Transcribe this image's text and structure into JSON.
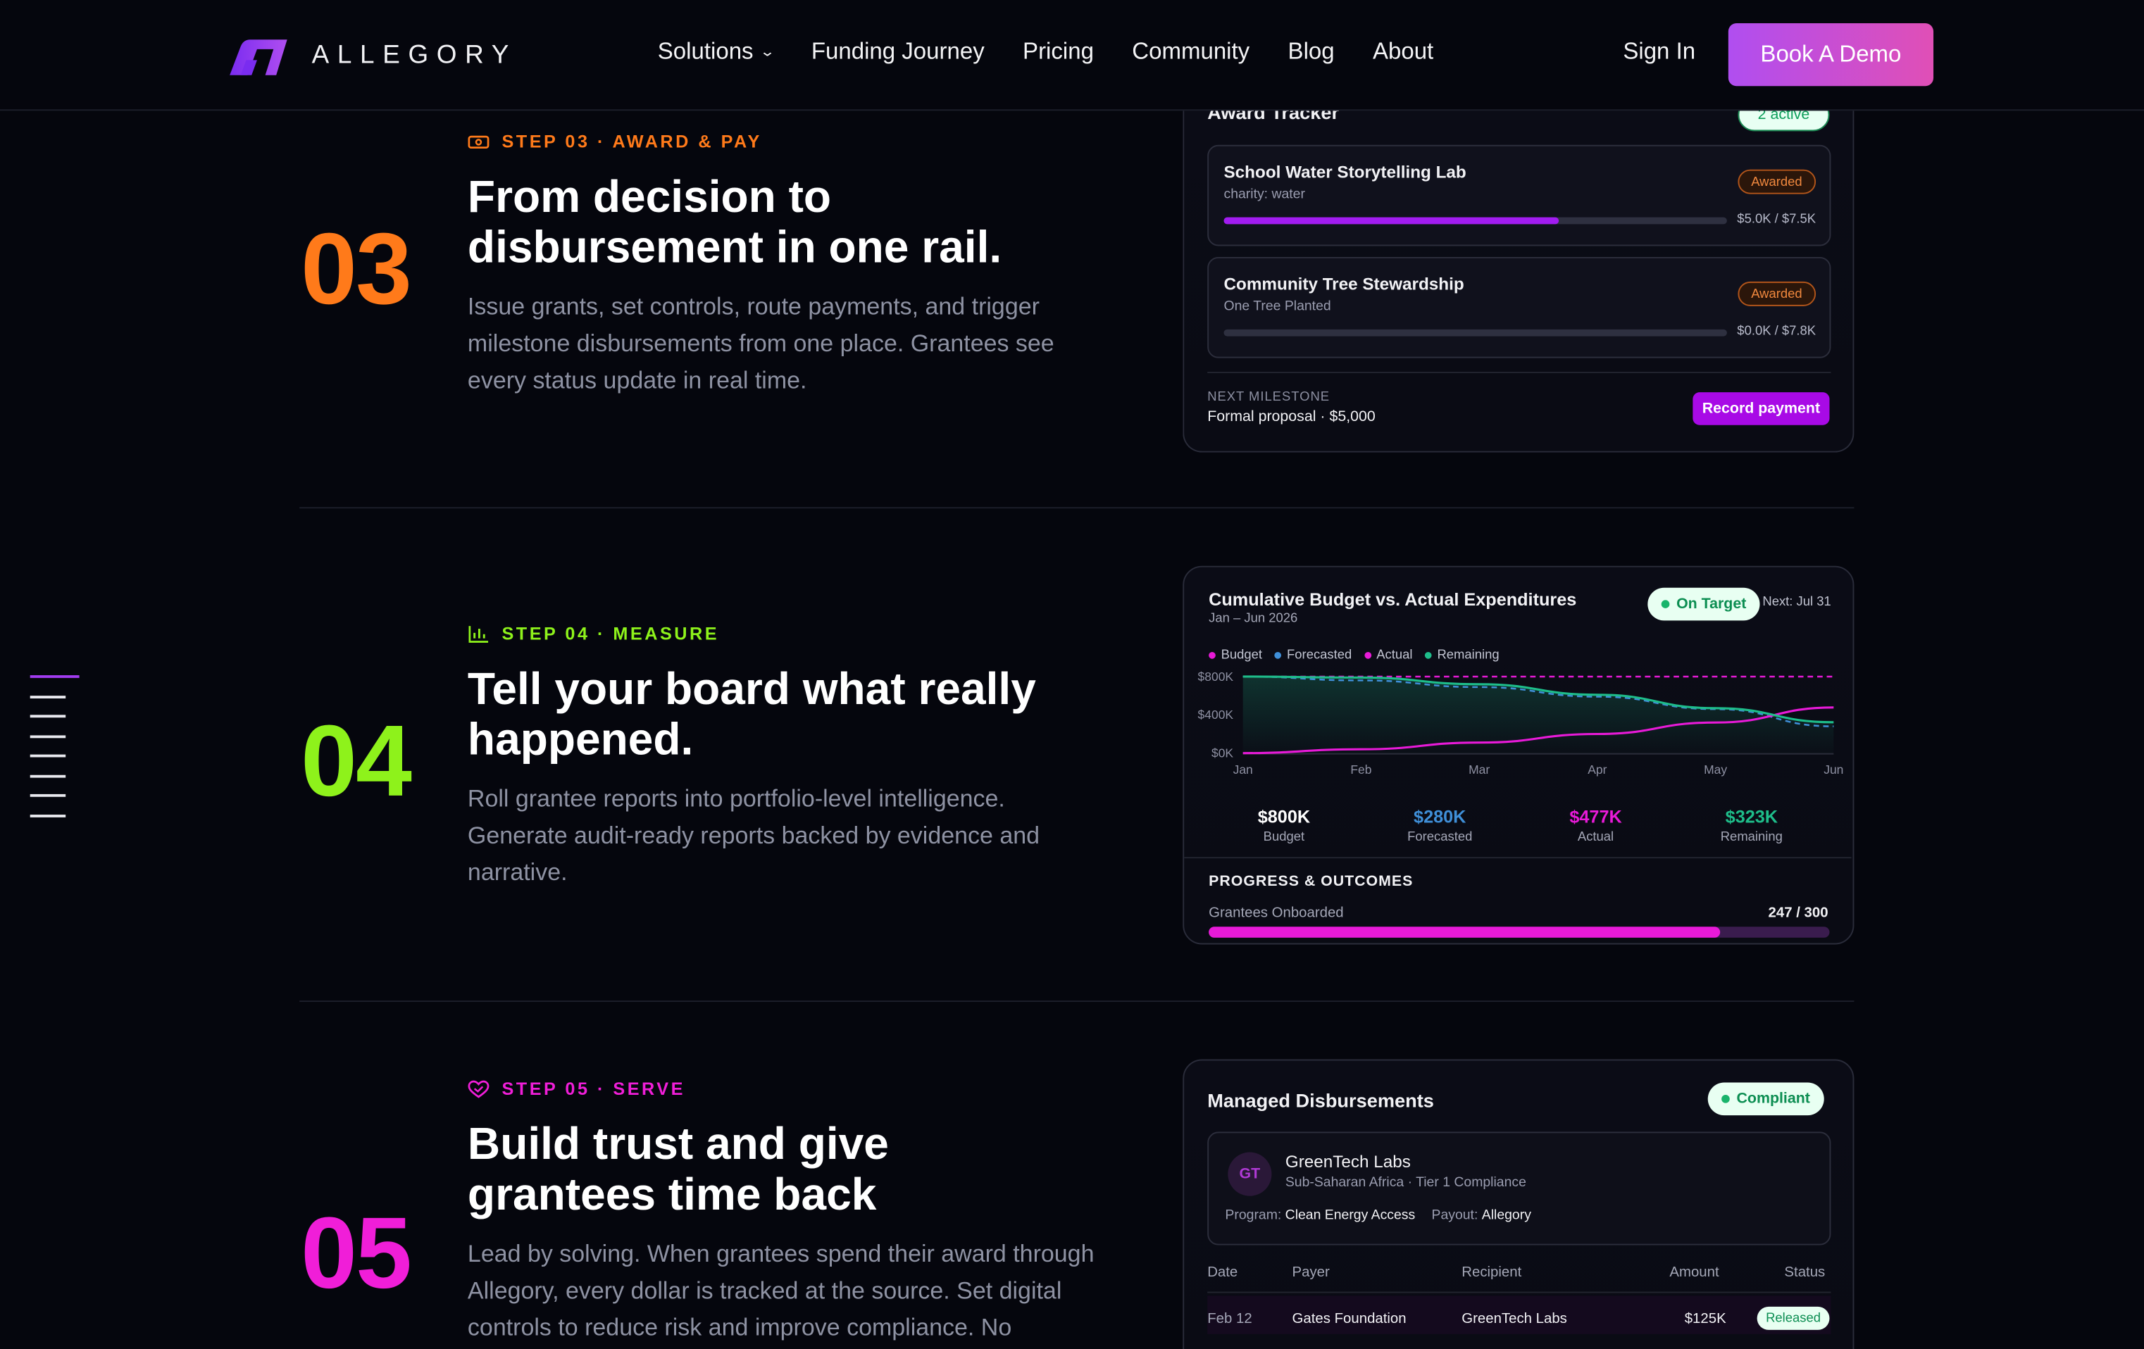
{
  "header": {
    "brand": "ALLEGORY",
    "nav": [
      "Solutions",
      "Funding Journey",
      "Pricing",
      "Community",
      "Blog",
      "About"
    ],
    "sign_in": "Sign In",
    "cta": "Book A Demo"
  },
  "rail": {
    "count": 8,
    "active_index": 0
  },
  "steps": [
    {
      "number": "03",
      "color": "#ff7a1a",
      "eyebrow": "STEP 03 · AWARD & PAY",
      "icon": "banknote-icon",
      "headline": "From decision to disbursement in one rail.",
      "body": "Issue grants, set controls, route payments, and trigger milestone disbursements from one place. Grantees see every status update in real time."
    },
    {
      "number": "04",
      "color": "#8ef21b",
      "eyebrow": "STEP 04 · MEASURE",
      "icon": "bar-chart-icon",
      "headline": "Tell your board what really happened.",
      "body": "Roll grantee reports into portfolio-level intelligence. Generate audit-ready reports backed by evidence and narrative."
    },
    {
      "number": "05",
      "color": "#f01ed8",
      "eyebrow": "STEP 05 · SERVE",
      "icon": "heart-hand-icon",
      "headline": "Build trust and give grantees time back",
      "body": "Lead by solving. When grantees spend their award through Allegory, every dollar is tracked at the source. Set digital controls to reduce risk and improve compliance. No"
    }
  ],
  "award_tracker": {
    "title": "Award Tracker",
    "badge": "2 active",
    "items": [
      {
        "title": "School Water Storytelling Lab",
        "org": "charity: water",
        "status": "Awarded",
        "amount": "$5.0K / $7.5K",
        "progress": 0.667
      },
      {
        "title": "Community Tree Stewardship",
        "org": "One Tree Planted",
        "status": "Awarded",
        "amount": "$0.0K / $7.8K",
        "progress": 0.0
      }
    ],
    "next_milestone_label": "NEXT MILESTONE",
    "next_milestone_value": "Formal proposal · $5,000",
    "action": "Record payment"
  },
  "budget_card": {
    "title": "Cumulative Budget vs. Actual Expenditures",
    "subtitle": "Jan – Jun 2026",
    "status": "On Target",
    "next": "Next: Jul 31",
    "kpis": [
      {
        "value": "$800K",
        "label": "Budget",
        "color": "#ffffff"
      },
      {
        "value": "$280K",
        "label": "Forecasted",
        "color": "#3f8fd8"
      },
      {
        "value": "$477K",
        "label": "Actual",
        "color": "#e81ad8"
      },
      {
        "value": "$323K",
        "label": "Remaining",
        "color": "#1ebd8a"
      }
    ],
    "progress_title": "PROGRESS & OUTCOMES",
    "progress_label": "Grantees Onboarded",
    "progress_value": "247 / 300",
    "progress_fraction": 0.823
  },
  "chart_data": {
    "type": "line",
    "x": [
      "Jan",
      "Feb",
      "Mar",
      "Apr",
      "May",
      "Jun"
    ],
    "yticks": [
      "$800K",
      "$400K",
      "$0K"
    ],
    "ylim": [
      0,
      800
    ],
    "legend": "top-left",
    "series": [
      {
        "name": "Budget",
        "color": "#e81ad8",
        "style": "dashed",
        "values": [
          800,
          800,
          800,
          800,
          800,
          800
        ]
      },
      {
        "name": "Forecasted",
        "color": "#3f8fd8",
        "style": "dashed",
        "values": [
          800,
          760,
          690,
          590,
          460,
          280
        ]
      },
      {
        "name": "Actual",
        "color": "#e81ad8",
        "style": "solid",
        "values": [
          0,
          40,
          110,
          200,
          320,
          477
        ]
      },
      {
        "name": "Remaining",
        "color": "#1ebd8a",
        "style": "solid",
        "values": [
          800,
          790,
          720,
          610,
          470,
          323
        ]
      }
    ]
  },
  "disbursements": {
    "title": "Managed Disbursements",
    "status": "Compliant",
    "org": {
      "initials": "GT",
      "name": "GreenTech Labs",
      "sub": "Sub-Saharan Africa · Tier 1 Compliance",
      "program_label": "Program:",
      "program": "Clean Energy Access",
      "payout_label": "Payout:",
      "payout": "Allegory"
    },
    "columns": [
      "Date",
      "Payer",
      "Recipient",
      "Amount",
      "Status"
    ],
    "rows": [
      {
        "date": "Feb 12",
        "payer": "Gates Foundation",
        "recipient": "GreenTech Labs",
        "amount": "$125K",
        "status": "Released"
      }
    ]
  }
}
